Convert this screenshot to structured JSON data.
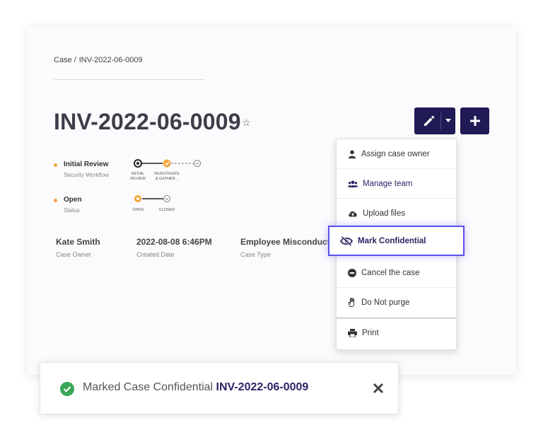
{
  "breadcrumb": {
    "root": "Case",
    "separator": "/",
    "current": "INV-2022-06-0009"
  },
  "case": {
    "title": "INV-2022-06-0009",
    "star": "☆"
  },
  "workflow": {
    "label": "Initial Review",
    "sublabel": "Security Workflow",
    "steps": [
      {
        "label_line1": "INITIAL",
        "label_line2": "REVIEW",
        "state": "current"
      },
      {
        "label_line1": "INVESTIGATE",
        "label_line2": "& GATHER...",
        "state": "done"
      },
      {
        "label_line1": "",
        "label_line2": "",
        "state": "pending"
      }
    ]
  },
  "status": {
    "label": "Open",
    "sublabel": "Status",
    "steps": [
      {
        "label": "OPEN",
        "state": "current"
      },
      {
        "label": "CLOSED",
        "state": "pending"
      }
    ]
  },
  "info": [
    {
      "value": "Kate Smith",
      "key": "Case Owner"
    },
    {
      "value": "2022-08-08 6:46PM",
      "key": "Created Date"
    },
    {
      "value": "Employee Misconduct",
      "key": "Case Type"
    }
  ],
  "menu": {
    "items": [
      {
        "label": "Assign case owner",
        "icon": "user-icon"
      },
      {
        "label": "Manage team",
        "icon": "team-icon"
      },
      {
        "label": "Upload files",
        "icon": "cloud-upload-icon"
      },
      {
        "label": "Mark Confidential",
        "icon": "eye-slash-icon"
      },
      {
        "label": "Cancel the case",
        "icon": "minus-circle-icon"
      },
      {
        "label": "Do Not purge",
        "icon": "hand-icon"
      },
      {
        "label": "Print",
        "icon": "print-icon"
      }
    ]
  },
  "toast": {
    "message": "Marked Case Confidential",
    "case_id": "INV-2022-06-0009"
  },
  "colors": {
    "primary": "#201a55",
    "accent": "#f2a73b",
    "highlight": "#5b4ff0",
    "success": "#3aa757"
  }
}
